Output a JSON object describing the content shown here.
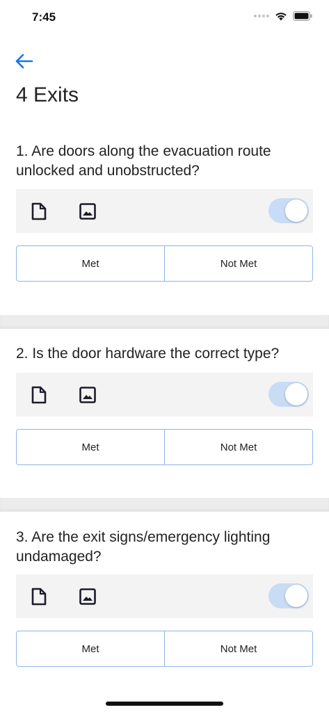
{
  "status_bar": {
    "time": "7:45"
  },
  "page": {
    "title": "4 Exits"
  },
  "questions": [
    {
      "text": "1. Are doors along the evacuation route unlocked and unobstructed?",
      "met_label": "Met",
      "not_met_label": "Not Met",
      "toggle_on": true
    },
    {
      "text": "2. Is the door hardware the correct type?",
      "met_label": "Met",
      "not_met_label": "Not Met",
      "toggle_on": true
    },
    {
      "text": "3. Are the exit signs/emergency lighting undamaged?",
      "met_label": "Met",
      "not_met_label": "Not Met",
      "toggle_on": true
    }
  ],
  "icons": {
    "back": "arrow-left-icon",
    "document": "document-icon",
    "image": "image-icon",
    "wifi": "wifi-icon",
    "battery": "battery-icon",
    "signal": "signal-icon"
  },
  "colors": {
    "accent": "#1a73e8",
    "segment_border": "#8fb3e6",
    "toggle_track": "#c9dcf5",
    "toolbar_bg": "#f3f3f3",
    "divider": "#ececec"
  }
}
